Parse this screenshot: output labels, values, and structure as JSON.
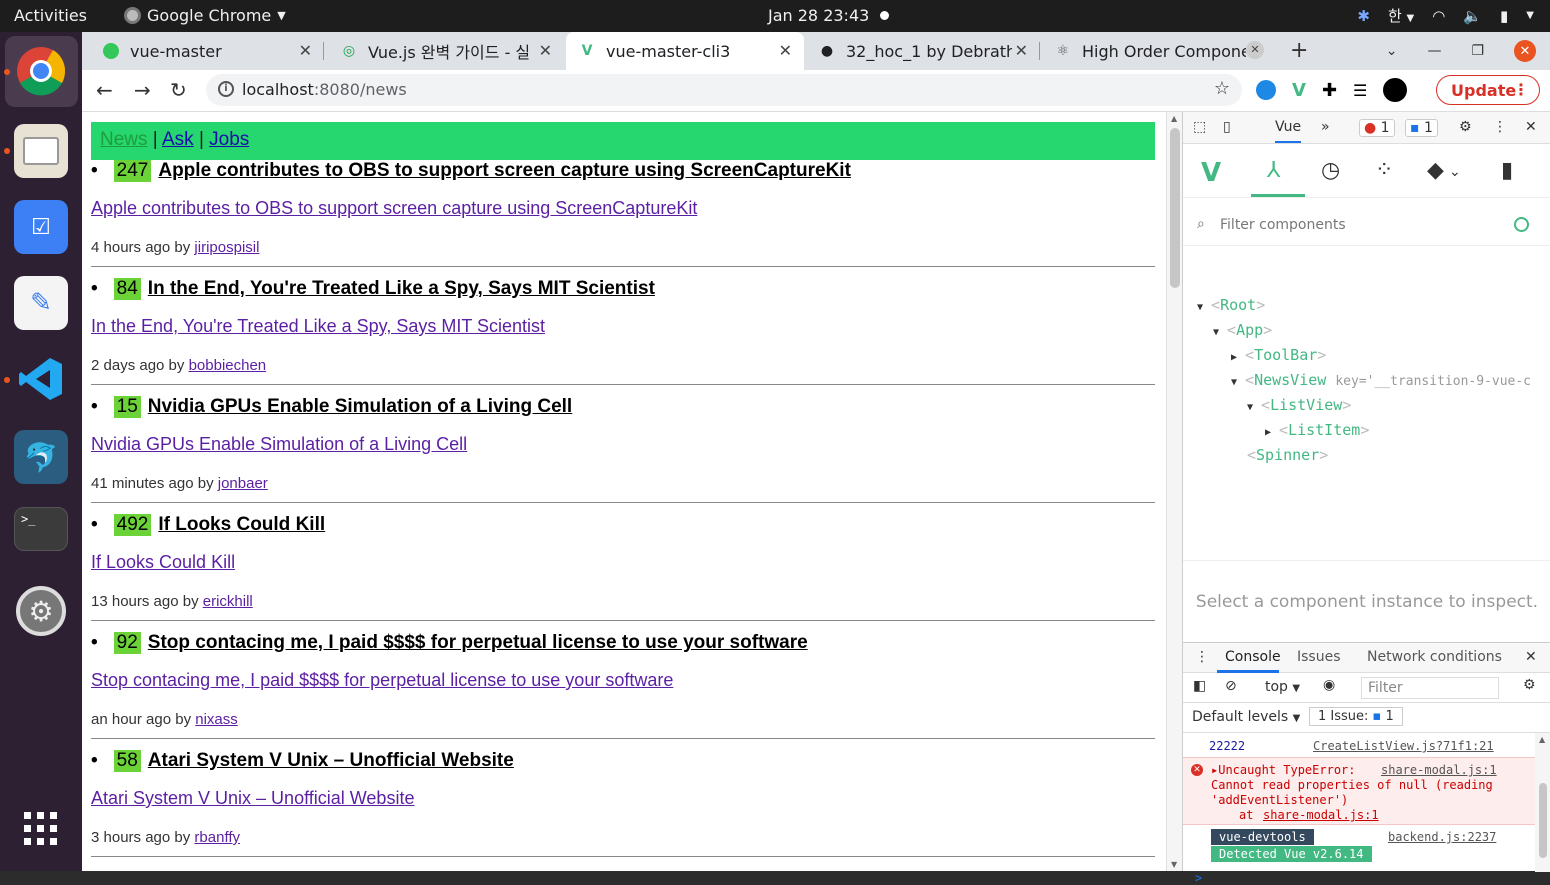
{
  "topbar": {
    "activities": "Activities",
    "app_name": "Google Chrome",
    "datetime": "Jan 28  23:43",
    "lang": "한"
  },
  "dock": {
    "items": [
      "chrome-icon",
      "files-icon",
      "tasks-icon",
      "text-editor-icon",
      "vscode-icon",
      "mysql-workbench-icon",
      "terminal-icon",
      "settings-icon",
      "app-grid-icon"
    ]
  },
  "tabs": [
    {
      "title": "vue-master",
      "icon": "green-circle"
    },
    {
      "title": "Vue.js 완벽 가이드 - 실",
      "icon": "inflearn"
    },
    {
      "title": "vue-master-cli3",
      "icon": "vue"
    },
    {
      "title": "32_hoc_1 by Debrath",
      "icon": "github"
    },
    {
      "title": "High Order Compone",
      "icon": "react"
    }
  ],
  "address": {
    "host": "localhost",
    "path": ":8080/news"
  },
  "update_label": "Update",
  "header": {
    "news": "News",
    "sep1": "|",
    "ask": "Ask",
    "sep2": "|",
    "jobs": "Jobs"
  },
  "items": [
    {
      "points": "247",
      "title": "Apple contributes to OBS to support screen capture using ScreenCaptureKit",
      "time": "4 hours ago by",
      "user": "jiripospisil"
    },
    {
      "points": "84",
      "title": "In the End, You're Treated Like a Spy, Says MIT Scientist",
      "time": "2 days ago by",
      "user": "bobbiechen"
    },
    {
      "points": "15",
      "title": "Nvidia GPUs Enable Simulation of a Living Cell",
      "time": "41 minutes ago by",
      "user": "jonbaer"
    },
    {
      "points": "492",
      "title": "If Looks Could Kill",
      "time": "13 hours ago by",
      "user": "erickhill"
    },
    {
      "points": "92",
      "title": "Stop contacing me, I paid $$$$ for perpetual license to use your software",
      "time": "an hour ago by",
      "user": "nixass"
    },
    {
      "points": "58",
      "title": "Atari System V Unix – Unofficial Website",
      "time": "3 hours ago by",
      "user": "rbanffy"
    }
  ],
  "devtools": {
    "tab_vue": "Vue",
    "more": "»",
    "err_count": "1",
    "msg_count": "1",
    "filter_placeholder": "Filter components",
    "tree": {
      "root": "Root",
      "app": "App",
      "toolbar": "ToolBar",
      "newsview": "NewsView",
      "newsview_key_attr": "key='__transition-9-vue-c",
      "listview": "ListView",
      "listitem": "ListItem",
      "spinner": "Spinner"
    },
    "inspect_msg": "Select a component instance to inspect.",
    "drawer_tabs": [
      "Console",
      "Issues",
      "Network conditions"
    ],
    "context": "top",
    "console_filter": "Filter",
    "default_levels": "Default levels",
    "issues_label": "1 Issue:",
    "issues_count": "1",
    "log": {
      "value": "22222",
      "value_src": "CreateListView.js?71f1:21",
      "err_title": "Uncaught TypeError:",
      "err_src": "share-modal.js:1",
      "err_line2": "Cannot read properties of null (reading",
      "err_line3": "'addEventListener')",
      "err_at": "at",
      "err_at_src": "share-modal.js:1",
      "vd_tag": "vue-devtools",
      "vd_src": "backend.js:2237",
      "vd_detected": "Detected Vue v2.6.14",
      "prompt": ">"
    }
  },
  "colors": {
    "header_green": "#26d66f",
    "points_green": "#6bd338",
    "vue_green": "#42b883",
    "ubuntu_orange": "#e95420"
  }
}
